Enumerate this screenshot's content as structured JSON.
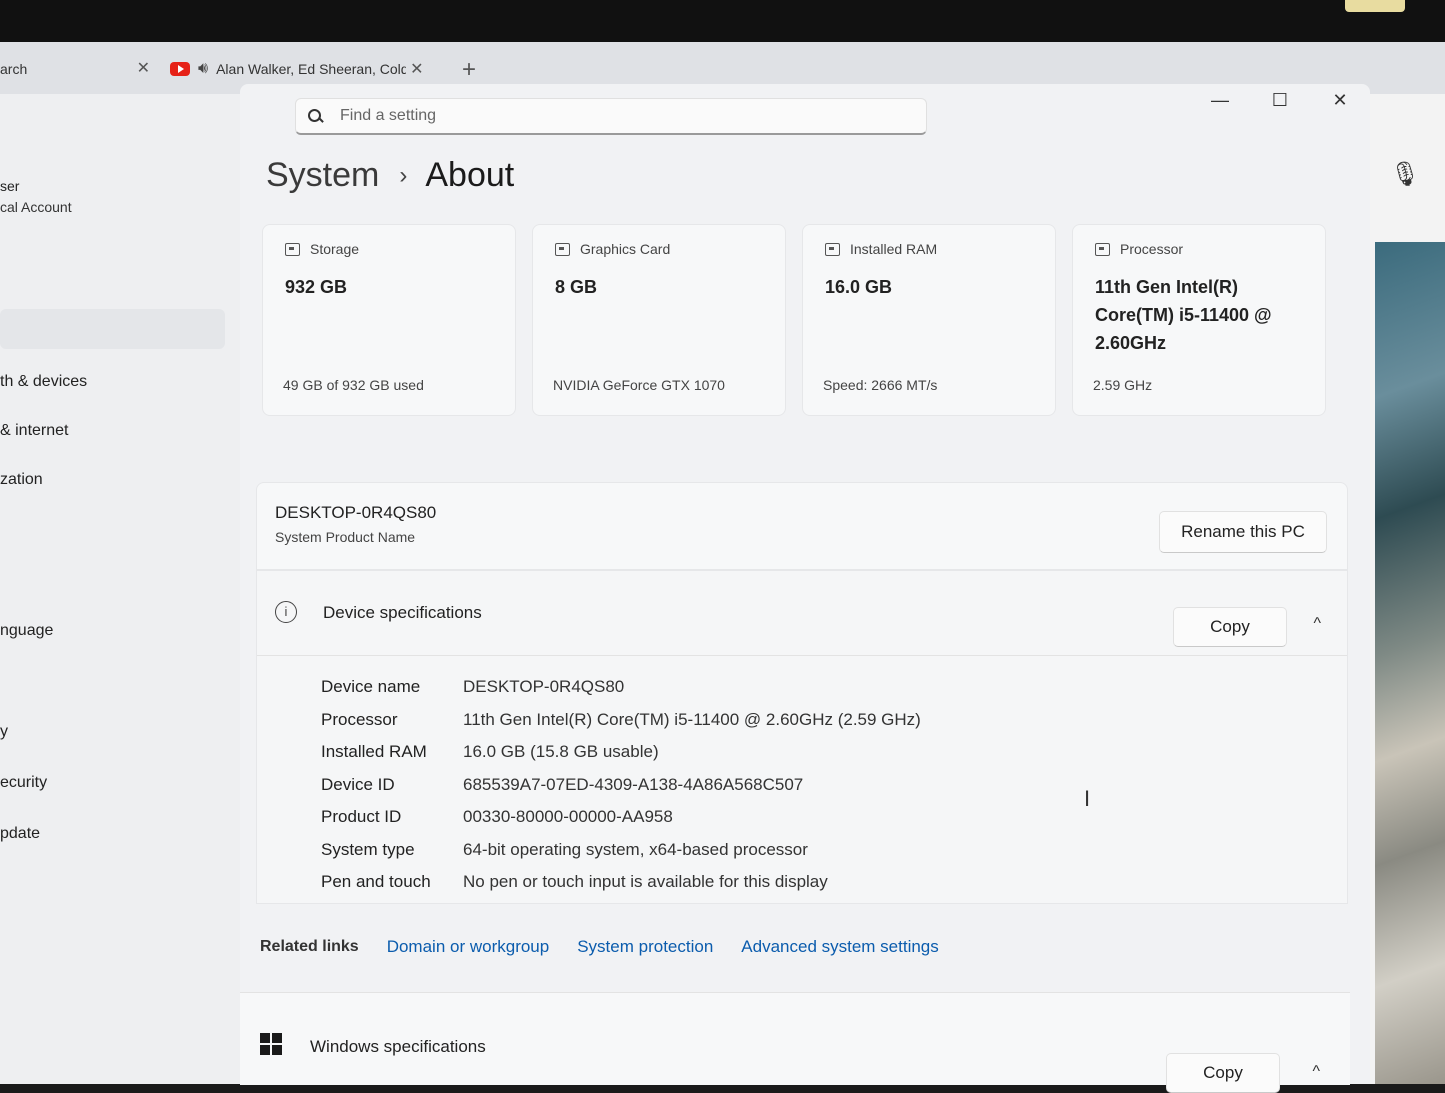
{
  "browser": {
    "tab_left_label": "arch",
    "tab_left_close": "✕",
    "tab_active_label": "Alan Walker, Ed Sheeran, Cold",
    "tab_active_close": "✕",
    "new_tab": "+"
  },
  "sidebar": {
    "user_name": "ser",
    "user_type": "cal Account",
    "items": [
      {
        "label": "th & devices"
      },
      {
        "label": "& internet"
      },
      {
        "label": "zation"
      },
      {
        "label": "nguage"
      },
      {
        "label": "y"
      },
      {
        "label": "ecurity"
      },
      {
        "label": "pdate"
      }
    ]
  },
  "window": {
    "controls": {
      "minimize": "—",
      "maximize": "☐",
      "close": "✕"
    },
    "search_placeholder": "Find a setting",
    "breadcrumb": {
      "parent": "System",
      "separator": "›",
      "current": "About"
    }
  },
  "cards": [
    {
      "title": "Storage",
      "value": "932 GB",
      "sub": "49 GB of 932 GB used"
    },
    {
      "title": "Graphics Card",
      "value": "8 GB",
      "sub": "NVIDIA GeForce GTX 1070"
    },
    {
      "title": "Installed RAM",
      "value": "16.0 GB",
      "sub": "Speed: 2666 MT/s"
    },
    {
      "title": "Processor",
      "value": "11th Gen Intel(R) Core(TM) i5-11400 @ 2.60GHz",
      "sub": "2.59 GHz"
    }
  ],
  "pc": {
    "hostname": "DESKTOP-0R4QS80",
    "label": "System Product Name",
    "rename_button": "Rename this PC"
  },
  "device_specs": {
    "title": "Device specifications",
    "copy_button": "Copy",
    "chevron": "^",
    "rows": [
      {
        "key": "Device name",
        "value": "DESKTOP-0R4QS80"
      },
      {
        "key": "Processor",
        "value": "11th Gen Intel(R) Core(TM) i5-11400 @ 2.60GHz (2.59 GHz)"
      },
      {
        "key": "Installed RAM",
        "value": "16.0 GB (15.8 GB usable)"
      },
      {
        "key": "Device ID",
        "value": "685539A7-07ED-4309-A138-4A86A568C507"
      },
      {
        "key": "Product ID",
        "value": "00330-80000-00000-AA958"
      },
      {
        "key": "System type",
        "value": "64-bit operating system, x64-based processor"
      },
      {
        "key": "Pen and touch",
        "value": "No pen or touch input is available for this display"
      }
    ]
  },
  "related_links": {
    "label": "Related links",
    "links": [
      "Domain or workgroup",
      "System protection",
      "Advanced system settings"
    ]
  },
  "windows_specs": {
    "title": "Windows specifications",
    "copy_button": "Copy",
    "chevron": "^"
  },
  "icons": {
    "mic": "microphone-icon",
    "cursor": "text-cursor-icon"
  }
}
